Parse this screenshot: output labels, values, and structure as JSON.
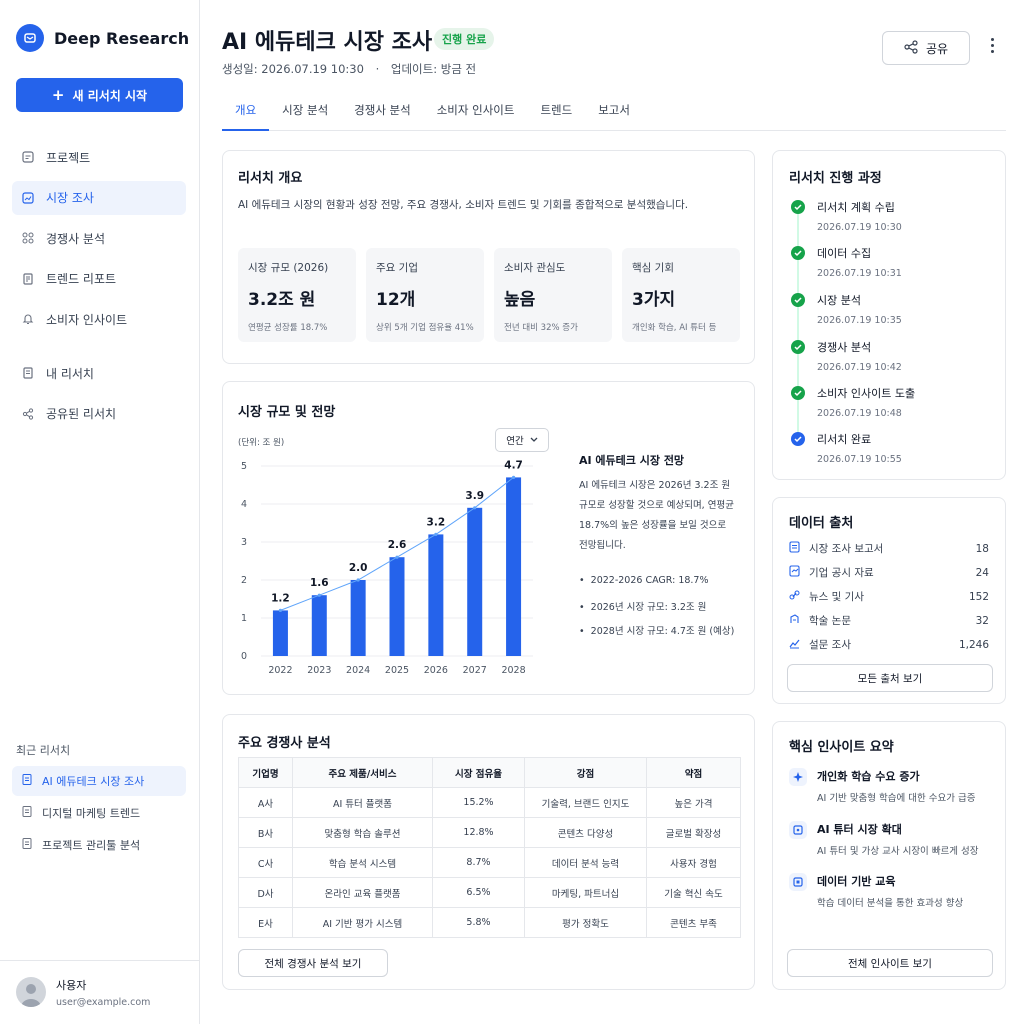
{
  "app": {
    "name": "Deep Research",
    "new_button": "새 리서치 시작"
  },
  "nav": [
    {
      "label": "프로젝트",
      "icon": "project-icon"
    },
    {
      "label": "시장 조사",
      "icon": "market-icon",
      "active": true
    },
    {
      "label": "경쟁사 분석",
      "icon": "competitor-icon"
    },
    {
      "label": "트렌드 리포트",
      "icon": "report-icon"
    },
    {
      "label": "소비자 인사이트",
      "icon": "bell-icon"
    }
  ],
  "nav2": [
    {
      "label": "내 리서치",
      "icon": "doc-icon"
    },
    {
      "label": "공유된 리서치",
      "icon": "share-icon"
    }
  ],
  "recent": {
    "title": "최근 리서치",
    "items": [
      {
        "label": "AI 에듀테크 시장 조사",
        "active": true
      },
      {
        "label": "디지털 마케팅 트렌드"
      },
      {
        "label": "프로젝트 관리툴 분석"
      }
    ]
  },
  "user": {
    "name": "사용자",
    "email": "user@example.com"
  },
  "header": {
    "title": "AI 에듀테크 시장 조사",
    "status": "진행 완료",
    "created": "생성일: 2026.07.19 10:30",
    "dot": "·",
    "updated": "업데이트: 방금 전",
    "share": "공유"
  },
  "tabs": [
    "개요",
    "시장 분석",
    "경쟁사 분석",
    "소비자 인사이트",
    "트렌드",
    "보고서"
  ],
  "overview": {
    "title": "리서치 개요",
    "desc": "AI 에듀테크 시장의 현황과 성장 전망, 주요 경쟁사, 소비자 트렌드 및 기회를 종합적으로 분석했습니다.",
    "kpis": [
      {
        "label": "시장 규모 (2026)",
        "value": "3.2조 원",
        "sub": "연평균 성장률 18.7%"
      },
      {
        "label": "주요 기업",
        "value": "12개",
        "sub": "상위 5개 기업 점유율 41%"
      },
      {
        "label": "소비자 관심도",
        "value": "높음",
        "sub": "전년 대비 32% 증가"
      },
      {
        "label": "핵심 기회",
        "value": "3가지",
        "sub": "개인화 학습, AI 튜터 등"
      }
    ]
  },
  "market": {
    "title": "시장 규모 및 전망",
    "unit": "(단위: 조 원)",
    "period": "연간",
    "summary_title": "AI 에듀테크 시장 전망",
    "summary": "AI 에듀테크 시장은 2026년 3.2조 원 규모로 성장할 것으로 예상되며, 연평균 18.7%의 높은 성장률을 보일 것으로 전망됩니다.",
    "bullets": [
      "2022-2026 CAGR: 18.7%",
      "2026년 시장 규모: 3.2조 원",
      "2028년 시장 규모: 4.7조 원 (예상)"
    ]
  },
  "chart_data": {
    "type": "bar",
    "categories": [
      "2022",
      "2023",
      "2024",
      "2025",
      "2026",
      "2027",
      "2028"
    ],
    "values": [
      1.2,
      1.6,
      2.0,
      2.6,
      3.2,
      3.9,
      4.7
    ],
    "ylim": [
      0,
      5
    ],
    "yticks": [
      0,
      1,
      2,
      3,
      4,
      5
    ],
    "ylabel": "(단위: 조 원)",
    "grid": true,
    "trend_line": true,
    "bar_color": "#2563eb"
  },
  "competitors": {
    "title": "주요 경쟁사 분석",
    "headers": [
      "기업명",
      "주요 제품/서비스",
      "시장 점유율",
      "강점",
      "약점"
    ],
    "rows": [
      [
        "A사",
        "AI 튜터 플랫폼",
        "15.2%",
        "기술력, 브랜드 인지도",
        "높은 가격"
      ],
      [
        "B사",
        "맞춤형 학습 솔루션",
        "12.8%",
        "콘텐츠 다양성",
        "글로벌 확장성"
      ],
      [
        "C사",
        "학습 분석 시스템",
        "8.7%",
        "데이터 분석 능력",
        "사용자 경험"
      ],
      [
        "D사",
        "온라인 교육 플랫폼",
        "6.5%",
        "마케팅, 파트너십",
        "기술 혁신 속도"
      ],
      [
        "E사",
        "AI 기반 평가 시스템",
        "5.8%",
        "평가 정확도",
        "콘텐츠 부족"
      ]
    ],
    "button": "전체 경쟁사 분석 보기"
  },
  "progress": {
    "title": "리서치 진행 과정",
    "steps": [
      {
        "label": "리서치 계획 수립",
        "time": "2026.07.19 10:30"
      },
      {
        "label": "데이터 수집",
        "time": "2026.07.19 10:31"
      },
      {
        "label": "시장 분석",
        "time": "2026.07.19 10:35"
      },
      {
        "label": "경쟁사 분석",
        "time": "2026.07.19 10:42"
      },
      {
        "label": "소비자 인사이트 도출",
        "time": "2026.07.19 10:48"
      },
      {
        "label": "리서치 완료",
        "time": "2026.07.19 10:55"
      }
    ]
  },
  "sources": {
    "title": "데이터 출처",
    "items": [
      {
        "label": "시장 조사 보고서",
        "count": "18"
      },
      {
        "label": "기업 공시 자료",
        "count": "24"
      },
      {
        "label": "뉴스 및 기사",
        "count": "152"
      },
      {
        "label": "학술 논문",
        "count": "32"
      },
      {
        "label": "설문 조사",
        "count": "1,246"
      }
    ],
    "button": "모든 출처 보기"
  },
  "insights": {
    "title": "핵심 인사이트 요약",
    "items": [
      {
        "title": "개인화 학습 수요 증가",
        "desc": "AI 기반 맞춤형 학습에 대한 수요가 급증"
      },
      {
        "title": "AI 튜터 시장 확대",
        "desc": "AI 튜터 및 가상 교사 시장이 빠르게 성장"
      },
      {
        "title": "데이터 기반 교육",
        "desc": "학습 데이터 분석을 통한 효과성 향상"
      }
    ],
    "button": "전체 인사이트 보기"
  },
  "colors": {
    "accent": "#2563eb",
    "success": "#16a34a"
  }
}
